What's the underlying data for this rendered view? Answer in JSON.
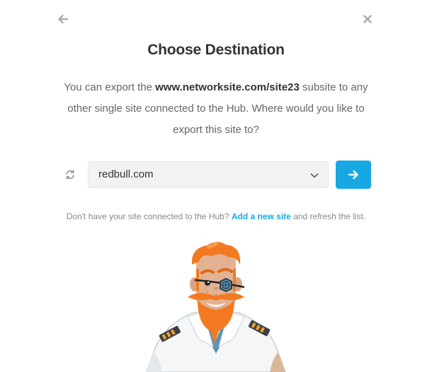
{
  "header": {
    "back_icon": "arrow-left-icon",
    "close_icon": "close-icon"
  },
  "title": "Choose Destination",
  "description": {
    "before": "You can export the ",
    "site": "www.networksite.com/site23",
    "after": " subsite to any other single site connected to the Hub. Where would you like to export this site to?"
  },
  "destination": {
    "refresh_icon": "refresh-icon",
    "selected_value": "redbull.com",
    "chevron_icon": "chevron-down-icon",
    "submit_icon": "arrow-right-icon"
  },
  "footer": {
    "before": "Don't have your site connected to the Hub? ",
    "link": "Add a new site",
    "after": " and refresh the list."
  },
  "illustration": {
    "name": "pirate-captain-mascot"
  },
  "colors": {
    "accent": "#17a8e3",
    "title": "#333333",
    "text": "#666666",
    "icon": "#aaaaaa"
  }
}
